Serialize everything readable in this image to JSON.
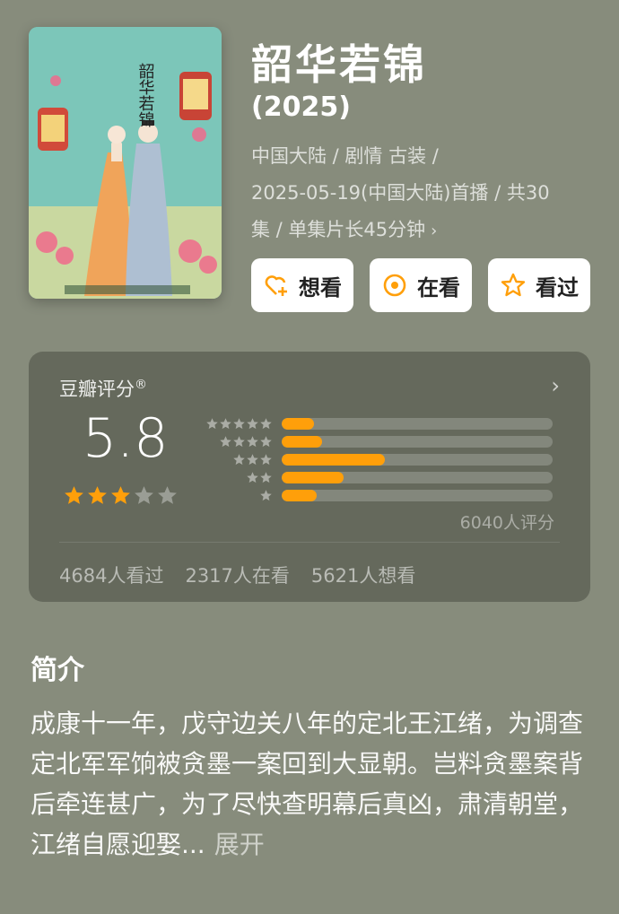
{
  "movie": {
    "title": "韶华若锦",
    "year": "(2025)",
    "meta_line1": "中国大陆 / 剧情 古装 /",
    "meta_line2": "2025-05-19(中国大陆)首播 / 共30",
    "meta_line3": "集 / 单集片长45分钟",
    "poster_title": "韶华若锦"
  },
  "actions": [
    {
      "label": "想看",
      "icon": "heart-plus-icon"
    },
    {
      "label": "在看",
      "icon": "target-circle-icon"
    },
    {
      "label": "看过",
      "icon": "star-outline-icon"
    }
  ],
  "rating": {
    "label": "豆瓣评分",
    "registered": "®",
    "score": "5.8",
    "stars_filled": 3,
    "stars_total": 5,
    "count": "6040人评分",
    "distribution": [
      {
        "stars": 5,
        "fraction": 0.12
      },
      {
        "stars": 4,
        "fraction": 0.15
      },
      {
        "stars": 3,
        "fraction": 0.38
      },
      {
        "stars": 2,
        "fraction": 0.23
      },
      {
        "stars": 1,
        "fraction": 0.13
      }
    ],
    "watched": "4684人看过",
    "watching": "2317人在看",
    "want": "5621人想看"
  },
  "intro": {
    "title": "简介",
    "text": "成康十一年，戊守边关八年的定北王江绪，为调查定北军军饷被贪墨一案回到大显朝。岂料贪墨案背后牵连甚广，为了尽快查明幕后真凶，肃清朝堂，江绪自愿迎娶...",
    "expand": "展开"
  },
  "colors": {
    "background": "#878c7c",
    "accent": "#ff9f0a",
    "card": "#5d6155"
  }
}
